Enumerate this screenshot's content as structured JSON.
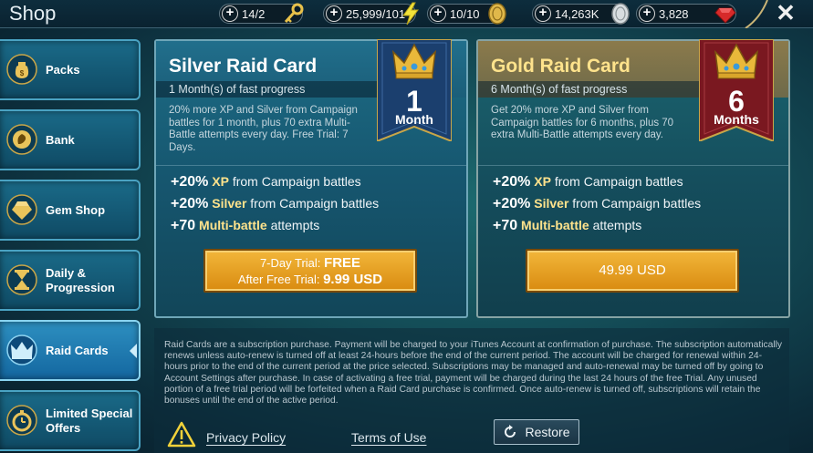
{
  "header": {
    "title": "Shop",
    "resources": [
      {
        "name": "energy-keys",
        "value": "14/2",
        "icon": "key-icon"
      },
      {
        "name": "energy",
        "value": "25,999/101",
        "icon": "lightning-icon"
      },
      {
        "name": "arena-tokens",
        "value": "10/10",
        "icon": "gold-coin-icon"
      },
      {
        "name": "silver",
        "value": "14,263K",
        "icon": "silver-coin-icon"
      },
      {
        "name": "gems",
        "value": "3,828",
        "icon": "ruby-icon"
      }
    ],
    "close_label": "✕"
  },
  "sidebar": {
    "items": [
      {
        "label": "Packs",
        "icon": "money-bag-icon"
      },
      {
        "label": "Bank",
        "icon": "bank-icon"
      },
      {
        "label": "Gem Shop",
        "icon": "gem-icon"
      },
      {
        "label": "Daily & Progression",
        "icon": "hourglass-icon"
      },
      {
        "label": "Raid Cards",
        "icon": "crown-icon",
        "active": true
      },
      {
        "label": "Limited Special Offers",
        "icon": "stopwatch-icon"
      }
    ]
  },
  "cards": [
    {
      "title": "Silver Raid Card",
      "subtitle": "1 Month(s) of fast progress",
      "description": "20% more XP and Silver from Campaign battles for 1 month, plus 70 extra Multi-Battle attempts every day. Free Trial: 7 Days.",
      "banner_number": "1",
      "banner_unit": "Month",
      "benefits": [
        {
          "amount": "+20%",
          "keyword": "XP",
          "rest": "from Campaign battles"
        },
        {
          "amount": "+20%",
          "keyword": "Silver",
          "rest": "from Campaign battles"
        },
        {
          "amount": "+70",
          "keyword": "Multi-battle",
          "rest": "attempts"
        }
      ],
      "button": {
        "line1_label": "7-Day Trial:",
        "line1_value": "FREE",
        "line2_label": "After Free Trial:",
        "line2_value": "9.99 USD"
      }
    },
    {
      "title": "Gold Raid Card",
      "subtitle": "6 Month(s) of fast progress",
      "description": "Get 20% more XP and Silver from Campaign battles for 6 months, plus 70 extra Multi-Battle attempts every day.",
      "banner_number": "6",
      "banner_unit": "Months",
      "benefits": [
        {
          "amount": "+20%",
          "keyword": "XP",
          "rest": "from Campaign battles"
        },
        {
          "amount": "+20%",
          "keyword": "Silver",
          "rest": "from Campaign battles"
        },
        {
          "amount": "+70",
          "keyword": "Multi-battle",
          "rest": "attempts"
        }
      ],
      "button": {
        "price": "49.99 USD"
      }
    }
  ],
  "footer": {
    "legal": "Raid Cards are a subscription purchase. Payment will be charged to your iTunes Account at confirmation of purchase. The subscription automatically renews unless auto-renew is turned off at least 24-hours before the end of the current period. The account will be charged for renewal within 24-hours prior to the end of the current period at the price selected. Subscriptions may be managed and auto-renewal may be turned off by going to Account Settings after purchase. In case of activating a free trial, payment will be charged during the last 24 hours of the free Trial. Any unused portion of a free trial period will be forfeited when a Raid Card purchase is confirmed. Once auto-renew is turned off, subscriptions will retain the bonuses until the end of the active period.",
    "privacy_label": "Privacy Policy",
    "terms_label": "Terms of Use",
    "restore_label": "Restore"
  },
  "colors": {
    "accent_gold": "#ffe38c",
    "button_orange": "#e9a428",
    "active_tab": "#2d8fc0",
    "silver_banner": "#1b3f6e",
    "gold_banner": "#7a1820"
  }
}
